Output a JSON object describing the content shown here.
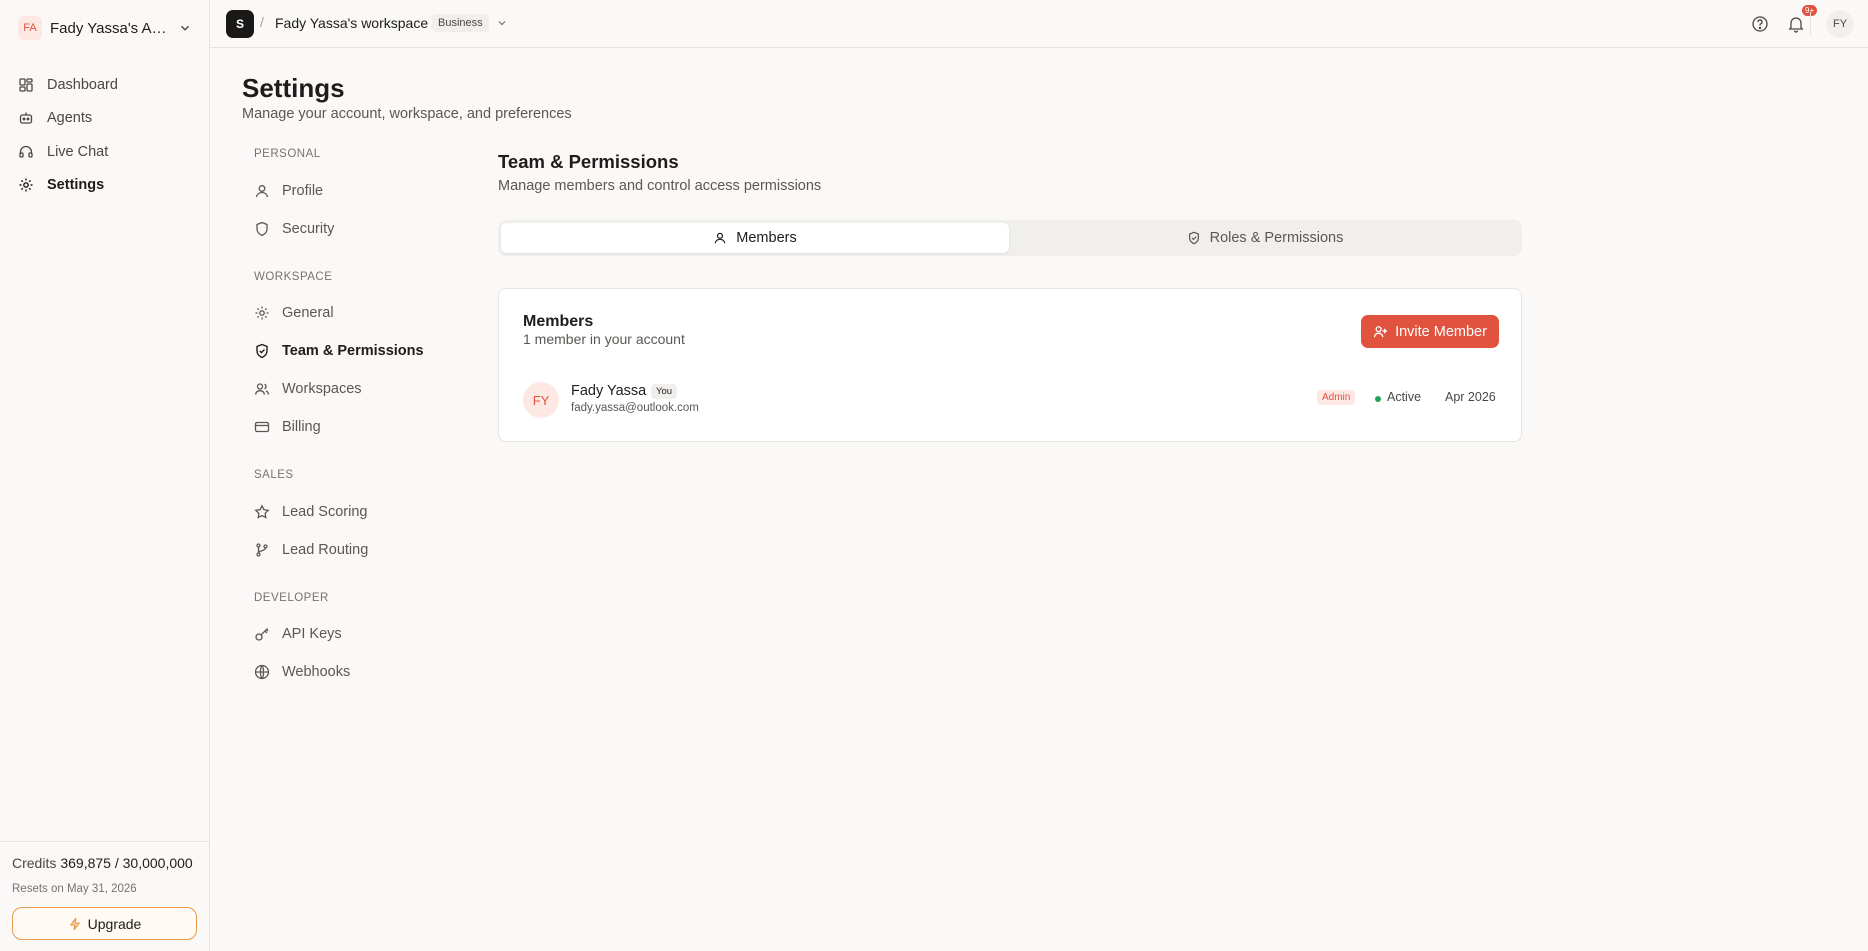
{
  "account": {
    "initials": "FA",
    "name": "Fady Yassa's Acco..."
  },
  "nav": [
    {
      "label": "Dashboard",
      "icon": "dashboard-icon"
    },
    {
      "label": "Agents",
      "icon": "robot-icon"
    },
    {
      "label": "Live Chat",
      "icon": "headset-icon"
    },
    {
      "label": "Settings",
      "icon": "gear-icon",
      "active": true
    }
  ],
  "credits": {
    "label": "Credits",
    "value": "369,875 / 30,000,000",
    "resets": "Resets on May 31, 2026",
    "upgrade_label": "Upgrade"
  },
  "topbar": {
    "workspace_initial": "S",
    "separator": "/",
    "workspace_name": "Fady Yassa's workspace",
    "plan": "Business",
    "notifications_badge": "9+",
    "user_initials": "FY"
  },
  "page": {
    "title": "Settings",
    "subtitle": "Manage your account, workspace, and preferences"
  },
  "settings_nav": {
    "personal": {
      "heading": "PERSONAL",
      "items": [
        "Profile",
        "Security"
      ]
    },
    "workspace": {
      "heading": "WORKSPACE",
      "items": [
        "General",
        "Team & Permissions",
        "Workspaces",
        "Billing"
      ]
    },
    "sales": {
      "heading": "SALES",
      "items": [
        "Lead Scoring",
        "Lead Routing"
      ]
    },
    "developer": {
      "heading": "DEVELOPER",
      "items": [
        "API Keys",
        "Webhooks"
      ]
    }
  },
  "section": {
    "title": "Team & Permissions",
    "subtitle": "Manage members and control access permissions",
    "tabs": [
      "Members",
      "Roles & Permissions"
    ]
  },
  "members_card": {
    "title": "Members",
    "subtitle": "1 member in your account",
    "invite_label": "Invite Member",
    "members": [
      {
        "initials": "FY",
        "name": "Fady Yassa",
        "you_badge": "You",
        "email": "fady.yassa@outlook.com",
        "role": "Admin",
        "status": "Active",
        "joined": "Apr 2026"
      }
    ]
  },
  "colors": {
    "accent": "#e2533f",
    "active_status": "#22a55a",
    "upgrade_border": "#e89a4a"
  }
}
